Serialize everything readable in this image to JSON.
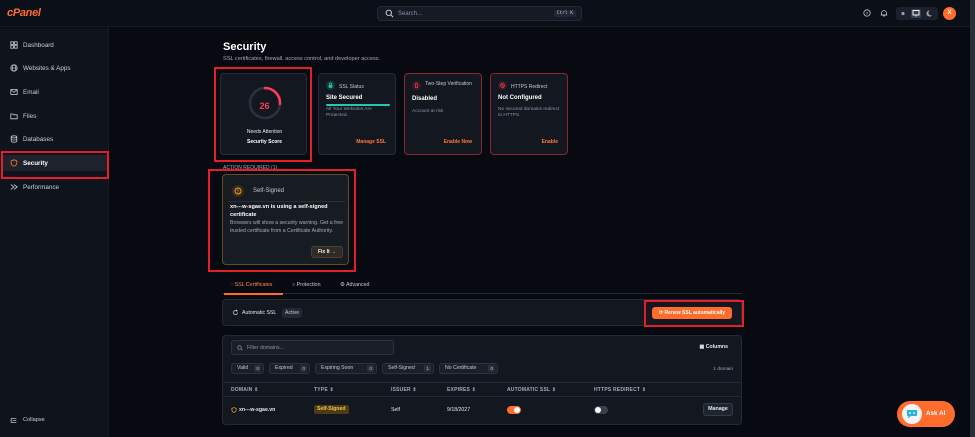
{
  "app": {
    "logo": "cPanel"
  },
  "topbar": {
    "search_placeholder": "Search...",
    "search_shortcut": "Ctrl K",
    "avatar_letter": "X"
  },
  "sidebar": {
    "items": [
      {
        "label": "Dashboard",
        "icon": "dashboard-icon"
      },
      {
        "label": "Websites & Apps",
        "icon": "globe-icon"
      },
      {
        "label": "Email",
        "icon": "mail-icon"
      },
      {
        "label": "Files",
        "icon": "folder-icon"
      },
      {
        "label": "Databases",
        "icon": "database-icon"
      },
      {
        "label": "Security",
        "icon": "shield-icon",
        "active": true
      },
      {
        "label": "Performance",
        "icon": "performance-icon"
      }
    ],
    "collapse_label": "Collapse"
  },
  "page": {
    "title": "Security",
    "subtitle": "SSL certificates, firewall, access control, and developer access."
  },
  "score_card": {
    "value": "26",
    "value_fraction": 0.26,
    "status": "Needs Attention",
    "label": "Security Score"
  },
  "stats": {
    "ssl": {
      "title": "SSL Status",
      "value": "Site Secured",
      "desc": "All Your Websites Are Protected.",
      "link": "Manage SSL"
    },
    "two_step": {
      "title": "Two-Step Verification",
      "value": "Disabled",
      "desc": "Account at risk",
      "link": "Enable Now"
    },
    "https": {
      "title": "HTTPS Redirect",
      "value": "Not Configured",
      "desc": "No secured domains redirect to HTTPS.",
      "link": "Enable"
    }
  },
  "action_required": {
    "label": "ACTION REQUIRED (1)",
    "type": "Self-Signed",
    "title": "xn---w-sgae.vn is using a self-signed certificate",
    "description": "Browsers will show a security warning. Get a free trusted certificate from a Certificate Authority.",
    "button": "Fix It"
  },
  "tabs": [
    {
      "label": "SSL Certificates",
      "active": true
    },
    {
      "label": "Protection"
    },
    {
      "label": "Advanced"
    }
  ],
  "auto_ssl": {
    "label": "Automatic SSL",
    "badge": "Active",
    "renew_button": "Renew SSL automatically"
  },
  "table": {
    "filter_placeholder": "Filter domains...",
    "columns_button": "Columns",
    "domain_count": "1 domain",
    "chips": [
      {
        "label": "Valid",
        "count": "0"
      },
      {
        "label": "Expired",
        "count": "0"
      },
      {
        "label": "Expiring Soon",
        "count": "0"
      },
      {
        "label": "Self-Signed",
        "count": "1"
      },
      {
        "label": "No Certificate",
        "count": "0"
      }
    ],
    "headers": {
      "domain": "DOMAIN",
      "type": "TYPE",
      "issuer": "ISSUER",
      "expires": "EXPIRES",
      "auto_ssl": "AUTOMATIC SSL",
      "https": "HTTPS REDIRECT"
    },
    "rows": [
      {
        "domain": "xn---w-sgae.vn",
        "type": "Self-Signed",
        "issuer": "Self",
        "expires": "9/18/2027",
        "auto_ssl": true,
        "https_redirect": false,
        "action": "Manage"
      }
    ]
  },
  "ask_ai": {
    "label": "Ask AI"
  },
  "colors": {
    "accent": "#ff6c2c",
    "danger": "#ff3b55",
    "success": "#27c6b2",
    "warning": "#f2c14e",
    "highlight_box": "#e21f2b",
    "background": "#070a10"
  }
}
